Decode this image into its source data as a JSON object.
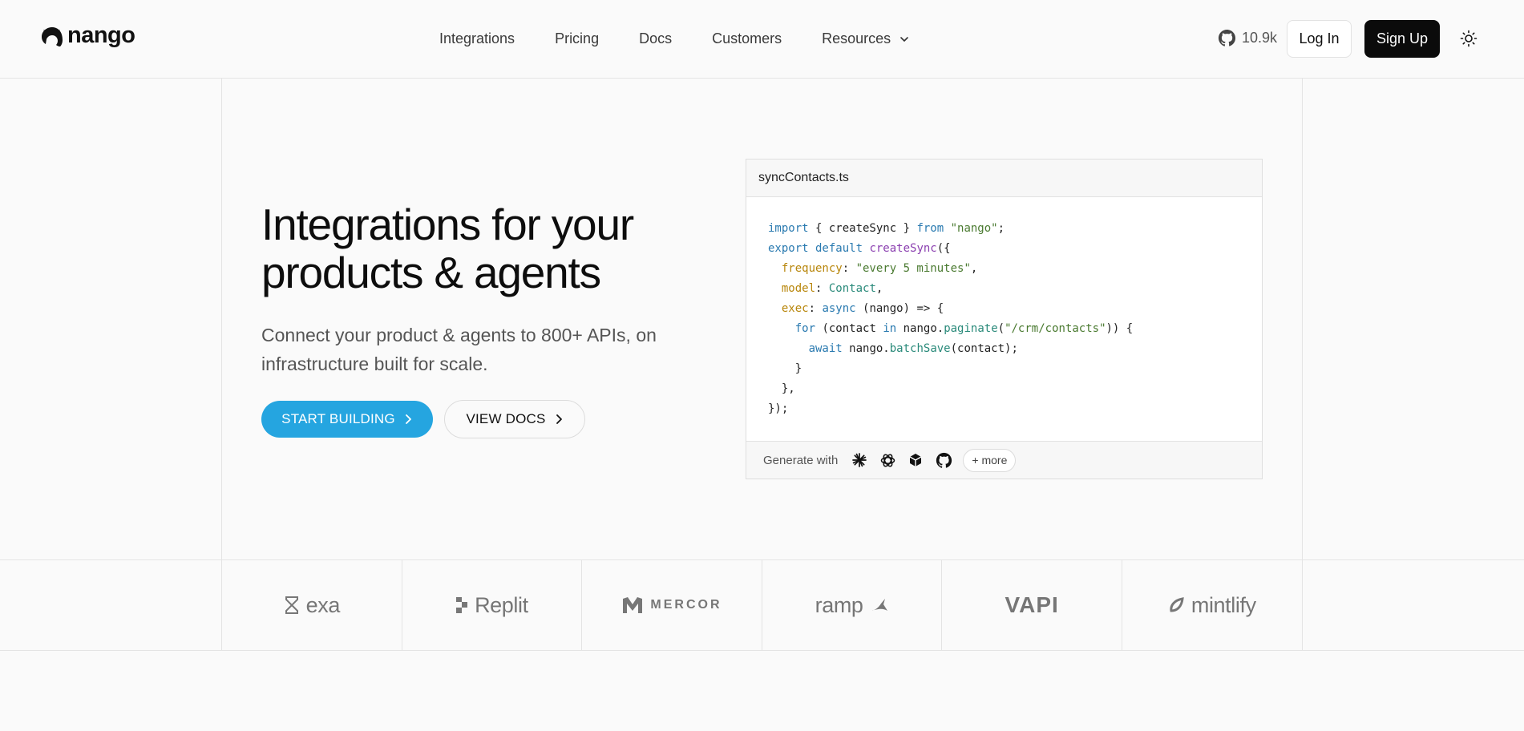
{
  "brand": {
    "name": "nango"
  },
  "nav": {
    "items": [
      {
        "label": "Integrations"
      },
      {
        "label": "Pricing"
      },
      {
        "label": "Docs"
      },
      {
        "label": "Customers"
      },
      {
        "label": "Resources"
      }
    ]
  },
  "header": {
    "github_stars": "10.9k",
    "login_label": "Log In",
    "signup_label": "Sign Up"
  },
  "hero": {
    "title_line1": "Integrations for your",
    "title_line2": "products & agents",
    "subtitle": "Connect your product & agents to 800+ APIs, on infrastructure built for scale.",
    "primary_cta": "START BUILDING",
    "secondary_cta": "VIEW DOCS"
  },
  "code_card": {
    "filename": "syncContacts.ts",
    "generate_label": "Generate with",
    "generate_tools": [
      "claude-icon",
      "openai-icon",
      "cube-icon",
      "github-icon"
    ],
    "more_label": "+ more",
    "lines": [
      "import { createSync } from \"nango\";",
      "export default createSync({",
      "  frequency: \"every 5 minutes\",",
      "  model: Contact,",
      "  exec: async (nango) => {",
      "    for (contact in nango.paginate(\"/crm/contacts\")) {",
      "      await nango.batchSave(contact);",
      "    }",
      "  },",
      "});"
    ]
  },
  "customers": {
    "logos": [
      "exa",
      "Replit",
      "MERCOR",
      "ramp",
      "VAPI",
      "mintlify"
    ]
  },
  "colors": {
    "accent": "#25a5e0",
    "dark_button": "#0b0b0b",
    "background": "#fafafa"
  }
}
